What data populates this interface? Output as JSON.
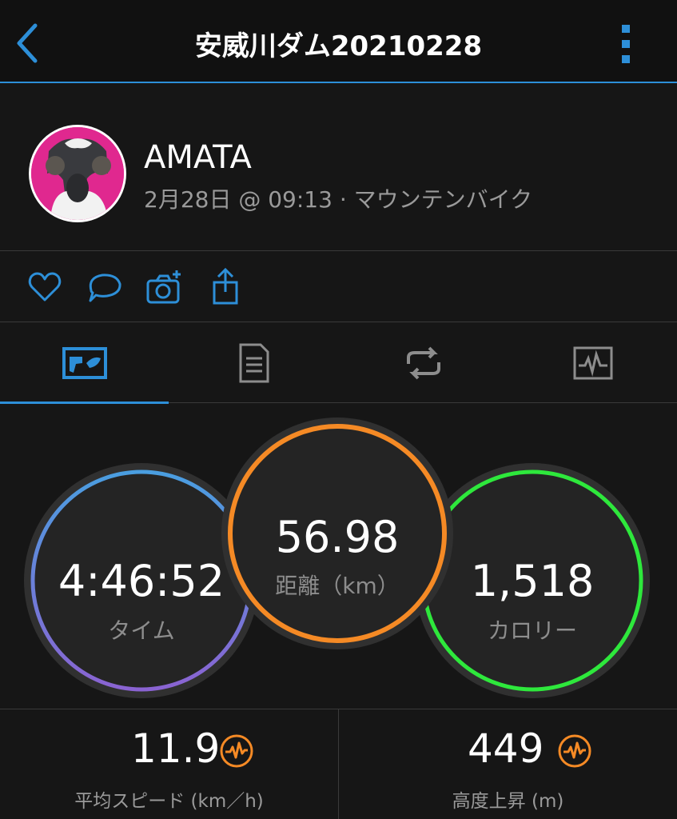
{
  "header": {
    "title": "安威川ダム20210228"
  },
  "profile": {
    "name": "AMATA",
    "meta": "2月28日 @ 09:13 · マウンテンバイク"
  },
  "tabs": [
    {
      "name": "overview",
      "icon": "map-icon",
      "active": true
    },
    {
      "name": "details",
      "icon": "document-list-icon",
      "active": false
    },
    {
      "name": "laps",
      "icon": "loop-icon",
      "active": false
    },
    {
      "name": "charts",
      "icon": "activity-chart-icon",
      "active": false
    }
  ],
  "stats": {
    "time": {
      "value": "4:46:52",
      "label": "タイム"
    },
    "distance": {
      "value": "56.98",
      "label": "距離（km）"
    },
    "calories": {
      "value": "1,518",
      "label": "カロリー"
    }
  },
  "metrics": {
    "avg_speed": {
      "value": "11.9",
      "label": "平均スピード (km／h)"
    },
    "elevation_gain": {
      "value": "449",
      "label": "高度上昇 (m)"
    }
  },
  "colors": {
    "accent": "#2d8fd8",
    "time_gradient_top": "#4a9ee0",
    "time_gradient_bottom": "#8a63d2",
    "distance": "#f58a25",
    "calories": "#2ee83c",
    "metric_icon": "#f58a25"
  }
}
